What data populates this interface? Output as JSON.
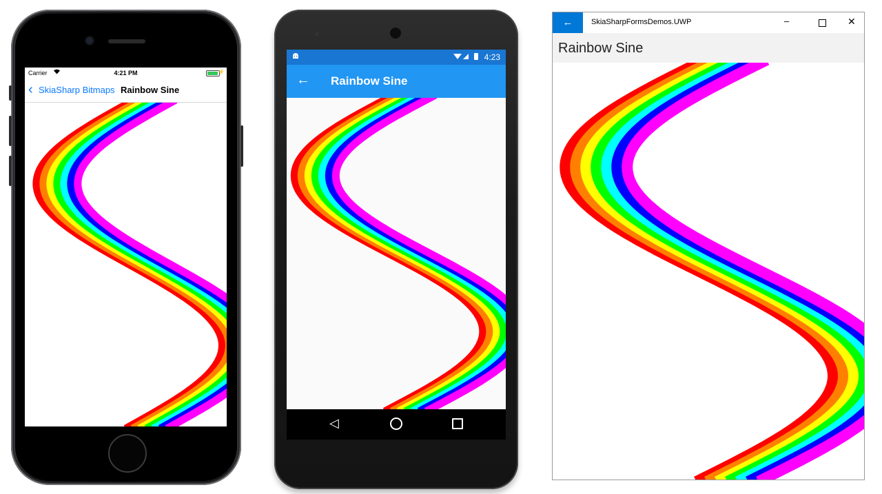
{
  "ios": {
    "carrier": "Carrier",
    "wifi_icon": "wifi-icon",
    "time": "4:21 PM",
    "back_label": "SkiaSharp Bitmaps",
    "back_chevron": "‹",
    "title": "Rainbow Sine"
  },
  "android": {
    "time": "4:23",
    "status_icons": "▾◢ ▮",
    "robot_icon": "android-icon",
    "back_arrow": "←",
    "title": "Rainbow Sine",
    "nav_back": "◁"
  },
  "uwp": {
    "back_arrow": "←",
    "app_title": "SkiaSharpFormsDemos.UWP",
    "minimize": "–",
    "close": "✕",
    "page_title": "Rainbow Sine"
  },
  "colors": {
    "ios_accent": "#0a7aff",
    "android_status": "#1976d2",
    "android_appbar": "#2196f3",
    "uwp_accent": "#0078d7",
    "rainbow": [
      "#ff0000",
      "#ff8000",
      "#ffff00",
      "#00ff00",
      "#00ffff",
      "#0000ff",
      "#ff00ff"
    ]
  }
}
